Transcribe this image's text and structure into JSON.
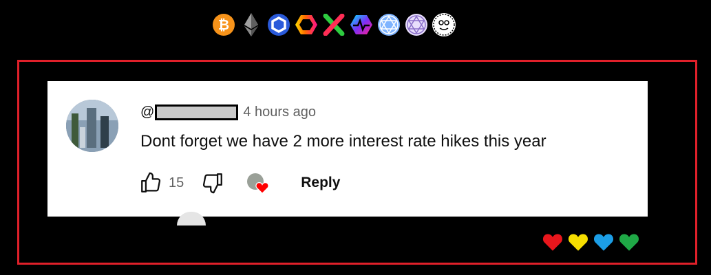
{
  "crypto_icons": [
    {
      "name": "bitcoin-icon",
      "color": "#f7931a"
    },
    {
      "name": "ethereum-icon",
      "color": "#8c8c8c"
    },
    {
      "name": "chainlink-icon",
      "color": "#2a5ada"
    },
    {
      "name": "hex-icon",
      "color": "#ff3d6e"
    },
    {
      "name": "xdc-icon",
      "color": "#2ecc40"
    },
    {
      "name": "pulse-icon",
      "color": "#7b2ff7"
    },
    {
      "name": "quant-icon-1",
      "color": "#7fb4ff"
    },
    {
      "name": "quant-icon-2",
      "color": "#d8c8ff"
    },
    {
      "name": "cartoon-face-icon",
      "color": "#ffffff"
    }
  ],
  "comment": {
    "at_sign": "@",
    "timestamp": "4 hours ago",
    "text": "Dont forget we have 2 more interest rate hikes this year",
    "like_count": "15",
    "reply_label": "Reply"
  },
  "accent": {
    "frame_border": "#e0202a",
    "creator_heart": "#ff0000"
  },
  "bottom_hearts": [
    "#e8161c",
    "#f6de00",
    "#1c9ee6",
    "#1fa846"
  ]
}
